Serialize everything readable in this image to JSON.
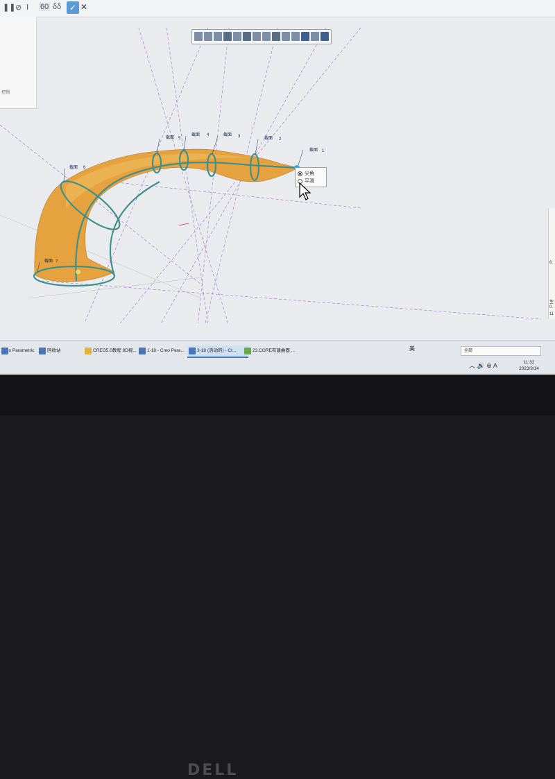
{
  "toolbar": {
    "pause_icon": "pause-icon",
    "confirm_label": "✓",
    "cancel_label": "✕",
    "glyph_labels": [
      "⊘",
      "Ⅰ",
      "60",
      "δδ"
    ]
  },
  "left_panel": {
    "label": "控制"
  },
  "graphics_toolbar": {
    "button_count": 14
  },
  "sections": [
    {
      "tag": "截面",
      "num": "1"
    },
    {
      "tag": "截面",
      "num": "2"
    },
    {
      "tag": "截面",
      "num": "3"
    },
    {
      "tag": "截面",
      "num": "4"
    },
    {
      "tag": "截面",
      "num": "5"
    },
    {
      "tag": "截面",
      "num": "6"
    },
    {
      "tag": "截面",
      "num": "7"
    }
  ],
  "context_menu": {
    "options": [
      {
        "label": "尖角",
        "selected": true
      },
      {
        "label": "平滑",
        "selected": false
      }
    ]
  },
  "taskbar": {
    "items": [
      {
        "label": "Creo Parametric"
      },
      {
        "label": "回收站"
      },
      {
        "label": "CREO5.0教程 8D视..."
      },
      {
        "label": "1-18 - Creo Para..."
      },
      {
        "label": "3-18 (活动的) - Cr..."
      },
      {
        "label": "23.CORE有建曲面 ..."
      }
    ],
    "ime_label": "美",
    "layer_filter": "全部",
    "clock": {
      "time": "11:32",
      "date": "2023/3/14"
    }
  },
  "brand": {
    "logo": "DELL"
  },
  "right_edge": {
    "labels": [
      "6.",
      "生'",
      "0.",
      "11"
    ]
  },
  "colors": {
    "shape": "#e5a23e",
    "curve": "#3f8f8a",
    "datum": "#9a6ec4",
    "selection": "#2aa4e0"
  }
}
